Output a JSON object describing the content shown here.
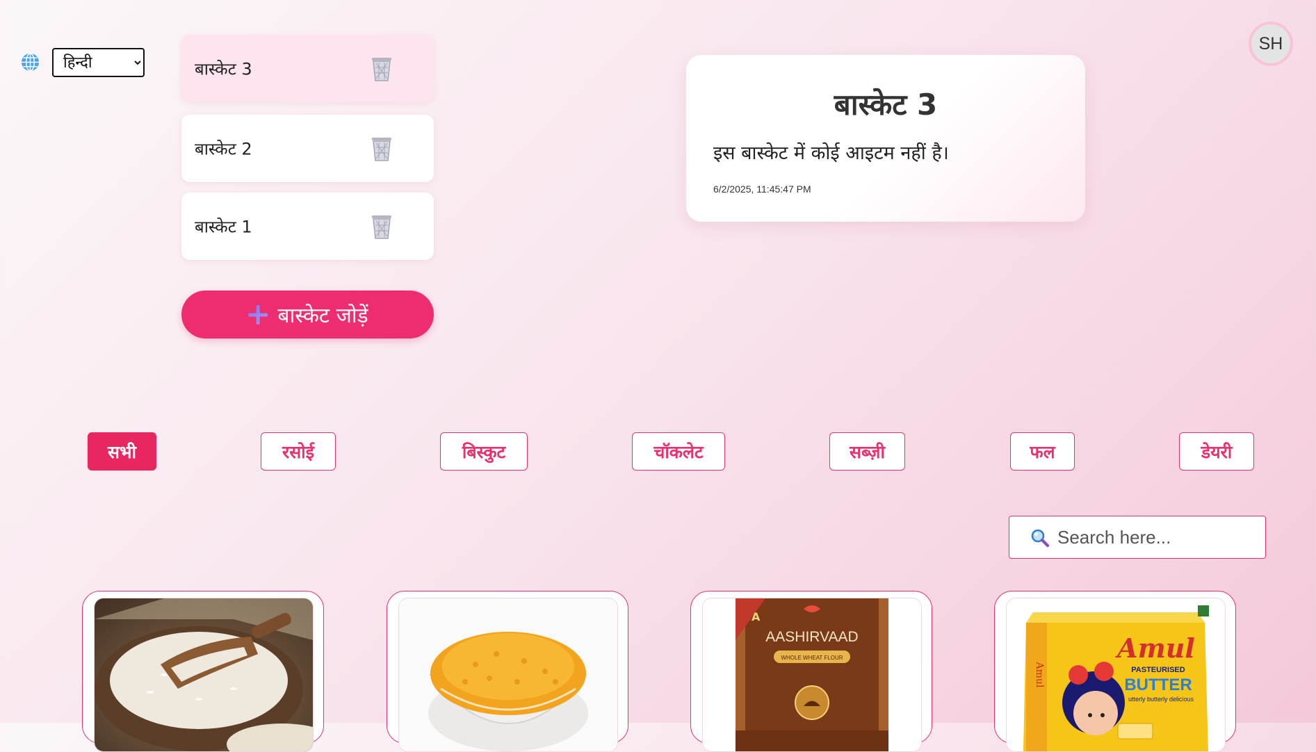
{
  "language": {
    "icon": "globe-icon",
    "selected": "हिन्दी",
    "options": [
      "हिन्दी"
    ]
  },
  "baskets": [
    {
      "label": "बास्केट 3",
      "active": true
    },
    {
      "label": "बास्केट 2",
      "active": false
    },
    {
      "label": "बास्केट 1",
      "active": false
    }
  ],
  "add_basket": {
    "label": "बास्केट जोड़ें",
    "icon": "plus-icon"
  },
  "detail": {
    "title": "बास्केट 3",
    "empty_message": "इस बास्केट में कोई आइटम नहीं है।",
    "timestamp": "6/2/2025, 11:45:47 PM"
  },
  "user": {
    "initials": "SH"
  },
  "categories": [
    {
      "label": "सभी",
      "active": true
    },
    {
      "label": "रसोई",
      "active": false
    },
    {
      "label": "बिस्कुट",
      "active": false
    },
    {
      "label": "चॉकलेट",
      "active": false
    },
    {
      "label": "सब्ज़ी",
      "active": false
    },
    {
      "label": "फल",
      "active": false
    },
    {
      "label": "डेयरी",
      "active": false
    }
  ],
  "search": {
    "placeholder": "Search here...",
    "value": "",
    "icon": "magnifier-icon"
  },
  "products": [
    {
      "image": "rice-bowl-image"
    },
    {
      "image": "lentils-bowl-image"
    },
    {
      "image": "flour-pack-image",
      "brand": "AASHIRVAAD",
      "subtitle": "WHOLE WHEAT FLOUR"
    },
    {
      "image": "butter-pack-image",
      "brand": "Amul",
      "tag1": "PASTEURISED",
      "tag2": "BUTTER",
      "tagline": "utterly butterly delicious"
    }
  ],
  "colors": {
    "accent": "#ee2d70",
    "active_basket": "#fde4ef",
    "border_pink": "#e8326f"
  }
}
